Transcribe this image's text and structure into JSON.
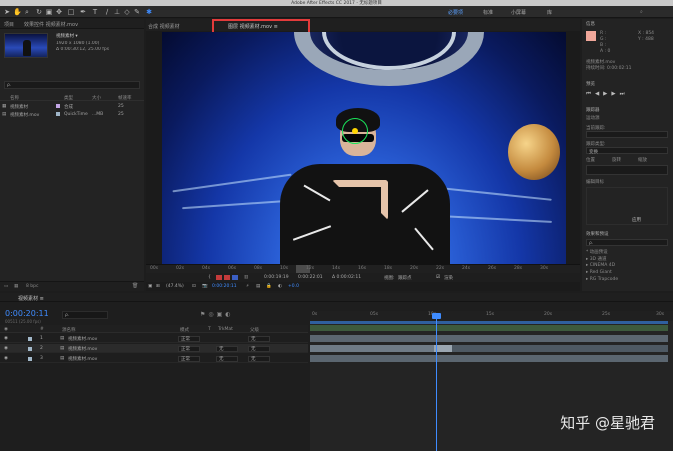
{
  "window_title": "Adobe After Effects CC 2017 - 无标题项目",
  "workspaces": [
    "必要项",
    "标准",
    "小屏幕",
    "库"
  ],
  "project": {
    "tabs": [
      "项目",
      "效果控件 视频素材.mov"
    ],
    "footage_name": "视频素材 ▾",
    "footage_info": [
      "1920 x 1080 (1.00)",
      "Δ 0:00:30:12, 25.00 fps"
    ],
    "search_placeholder": "ρ.",
    "columns": [
      "名称",
      "类型",
      "大小",
      "帧速率"
    ],
    "items": [
      {
        "name": "视频素材",
        "type": "合成",
        "size": "",
        "fps": "25"
      },
      {
        "name": "视频素材.mov",
        "type": "QuickTime",
        "size": "...MB",
        "fps": "25"
      }
    ],
    "footer": "8 bpc"
  },
  "viewer": {
    "tabs": [
      "合成 视频素材",
      "图层 视频素材.mov ≡"
    ],
    "ruler": [
      "00s",
      "02s",
      "04s",
      "06s",
      "08s",
      "10s",
      "12s",
      "14s",
      "16s",
      "18s",
      "20s",
      "22s",
      "24s",
      "26s",
      "28s",
      "30s"
    ],
    "ctrl1": {
      "zoom": "(47.4%)",
      "in": "0:00:19:19",
      "out": "0:00:22:01",
      "duration": "Δ 0:00:02:11",
      "view_label": "视图:",
      "view_value": "跟踪点",
      "render_label": "渲染"
    },
    "ctrl2": {
      "timecode": "0:00:20:11",
      "offset": "+0.0"
    }
  },
  "right": {
    "info_title": "信息",
    "info_values": [
      "R :",
      "G :",
      "B :",
      "A : 0",
      "X : 854",
      "Y : 488"
    ],
    "info_footer": [
      "视频素材.mov",
      "持续时间: 0:00:02:11"
    ],
    "preview_title": "预览",
    "tracker_title": "跟踪器",
    "track_mode": "运动源",
    "track_current": "当前跟踪:",
    "track_type": "跟踪类型:",
    "track_type_value": "变换",
    "options": [
      "位置",
      "旋转",
      "缩放"
    ],
    "edit_target": "编辑目标",
    "apply": "应用",
    "effects_title": "效果和预设",
    "effects_search": "ρ.",
    "effects_items": [
      "* 动画预设",
      "▸ 3D 通道",
      "▸ CINEMA 4D",
      "▸ Red Giant",
      "▸ RG Trapcode"
    ]
  },
  "timeline": {
    "tab": "视频素材 ≡",
    "timecode": "0:00:20:11",
    "timecode_sub": "00511 (25.00 fps)",
    "search_placeholder": "ρ.",
    "columns": [
      "#",
      "源名称",
      "模式",
      "T",
      "TrkMat",
      "父级"
    ],
    "layers": [
      {
        "index": "1",
        "name": "视频素材.mov",
        "mode": "正常",
        "trkmat": "",
        "parent": "无"
      },
      {
        "index": "2",
        "name": "视频素材.mov",
        "mode": "正常",
        "trkmat": "无",
        "parent": "无"
      },
      {
        "index": "3",
        "name": "视频素材.mov",
        "mode": "正常",
        "trkmat": "无",
        "parent": "无"
      }
    ],
    "ruler": [
      "0s",
      "05s",
      "10s",
      "15s",
      "20s",
      "25s",
      "30s"
    ]
  },
  "watermark": "知乎 @星驰君",
  "colors": {
    "accent": "#3f8cff",
    "highlight_box": "#e23b3b",
    "track_ring": "#19e45a",
    "track_point": "#ffd600"
  }
}
